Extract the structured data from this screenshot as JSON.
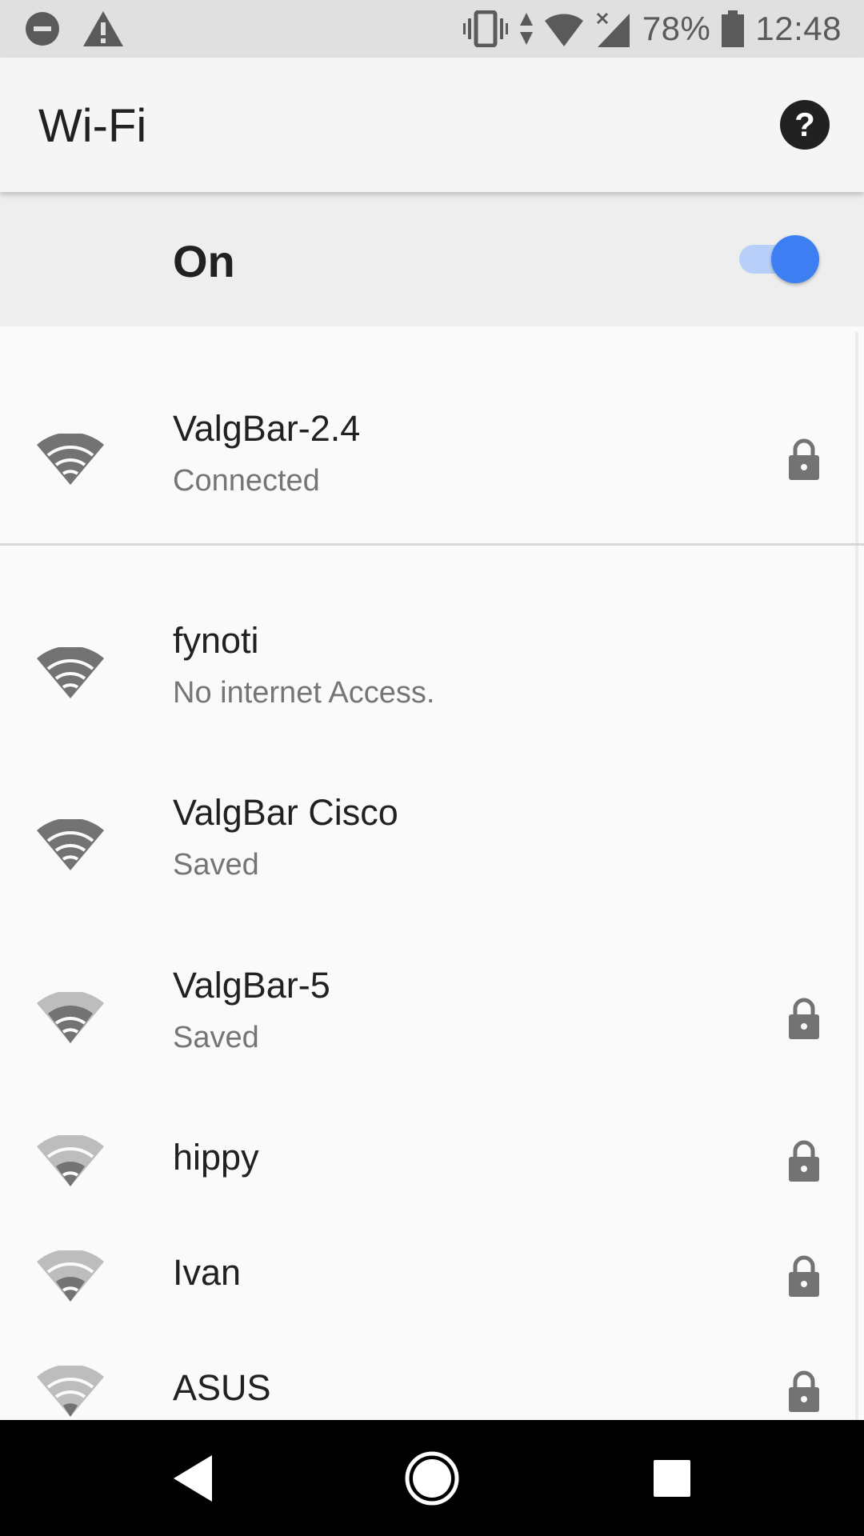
{
  "status_bar": {
    "battery_percent": "78%",
    "time": "12:48",
    "icons": [
      "do-not-disturb-icon",
      "alert-icon",
      "vibrate-icon",
      "data-arrows-icon",
      "wifi-status-icon",
      "cellular-no-signal-icon",
      "battery-icon"
    ]
  },
  "header": {
    "title": "Wi-Fi",
    "help_icon": "help-icon"
  },
  "master_switch": {
    "label": "On",
    "enabled": true,
    "accent_color": "#3d7ff2"
  },
  "networks": [
    {
      "name": "ValgBar-2.4",
      "status": "Connected",
      "secured": true,
      "signal": 4
    },
    {
      "name": "fynoti",
      "status": "No internet Access.",
      "secured": false,
      "signal": 4
    },
    {
      "name": "ValgBar Cisco",
      "status": "Saved",
      "secured": false,
      "signal": 4
    },
    {
      "name": "ValgBar-5",
      "status": "Saved",
      "secured": true,
      "signal": 3
    },
    {
      "name": "hippy",
      "status": "",
      "secured": true,
      "signal": 2
    },
    {
      "name": "Ivan",
      "status": "",
      "secured": true,
      "signal": 2
    },
    {
      "name": "ASUS",
      "status": "",
      "secured": true,
      "signal": 1
    }
  ],
  "nav_bar": {
    "icons": [
      "back-icon",
      "home-icon",
      "recents-icon"
    ]
  }
}
